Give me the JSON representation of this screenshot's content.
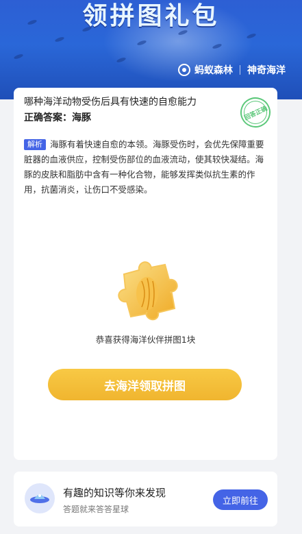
{
  "banner": {
    "title": "领拼图礼包",
    "brand_left": "蚂蚁森林",
    "brand_right": "神奇海洋"
  },
  "question": {
    "title": "哪种海洋动物受伤后具有快速的自愈能力",
    "answer": "正确答案：海豚",
    "stamp": "回答正确",
    "explain_tag": "解析",
    "explain_text": "海豚有着快速自愈的本领。海豚受伤时，会优先保障重要脏器的血液供应，控制受伤部位的血液流动，使其较快凝结。海豚的皮肤和脂肪中含有一种化合物，能够发挥类似抗生素的作用，抗菌消炎，让伤口不受感染。"
  },
  "reward": {
    "icon": "puzzle-piece-icon",
    "message": "恭喜获得海洋伙伴拼图1块",
    "button": "去海洋领取拼图"
  },
  "promo": {
    "icon": "planet-ufo-icon",
    "title": "有趣的知识等你来发现",
    "subtitle": "答题就来答答星球",
    "button": "立即前往"
  },
  "colors": {
    "accent": "#4464e6",
    "gold": "#f0b52f",
    "correct": "#5cc87a"
  }
}
